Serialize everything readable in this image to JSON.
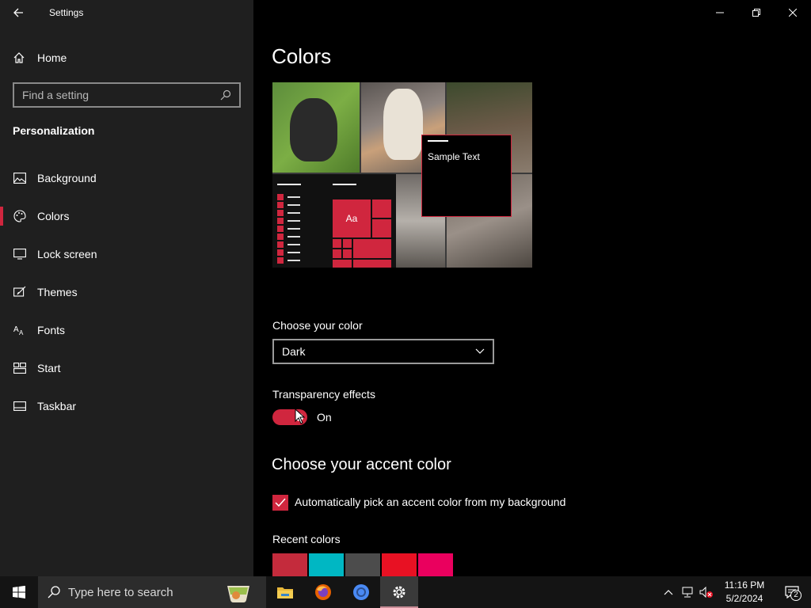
{
  "window": {
    "title": "Settings"
  },
  "sidebar": {
    "home_label": "Home",
    "search_placeholder": "Find a setting",
    "section_title": "Personalization",
    "items": [
      {
        "label": "Background",
        "icon": "image-icon"
      },
      {
        "label": "Colors",
        "icon": "palette-icon",
        "active": true
      },
      {
        "label": "Lock screen",
        "icon": "lock-screen-icon"
      },
      {
        "label": "Themes",
        "icon": "themes-icon"
      },
      {
        "label": "Fonts",
        "icon": "fonts-icon"
      },
      {
        "label": "Start",
        "icon": "start-icon"
      },
      {
        "label": "Taskbar",
        "icon": "taskbar-icon"
      }
    ]
  },
  "main": {
    "title": "Colors",
    "preview": {
      "sample_text": "Sample Text",
      "tile_text": "Aa"
    },
    "choose_color": {
      "label": "Choose your color",
      "value": "Dark"
    },
    "transparency": {
      "label": "Transparency effects",
      "state": "On",
      "enabled": true
    },
    "accent": {
      "heading": "Choose your accent color",
      "auto_pick_label": "Automatically pick an accent color from my background",
      "auto_pick_checked": true,
      "recent_label": "Recent colors",
      "recent_colors": [
        "#c42b3c",
        "#00b7c3",
        "#4c4c4c",
        "#e81123",
        "#ea005e"
      ]
    }
  },
  "taskbar": {
    "search_placeholder": "Type here to search",
    "apps": [
      "file-explorer-icon",
      "firefox-icon",
      "chrome-icon",
      "settings-icon"
    ],
    "clock_time": "11:16 PM",
    "clock_date": "5/2/2024",
    "notification_count": "2"
  },
  "colors": {
    "accent": "#d0263e",
    "sidebar_bg": "#1f1f1f",
    "main_bg": "#000000"
  }
}
